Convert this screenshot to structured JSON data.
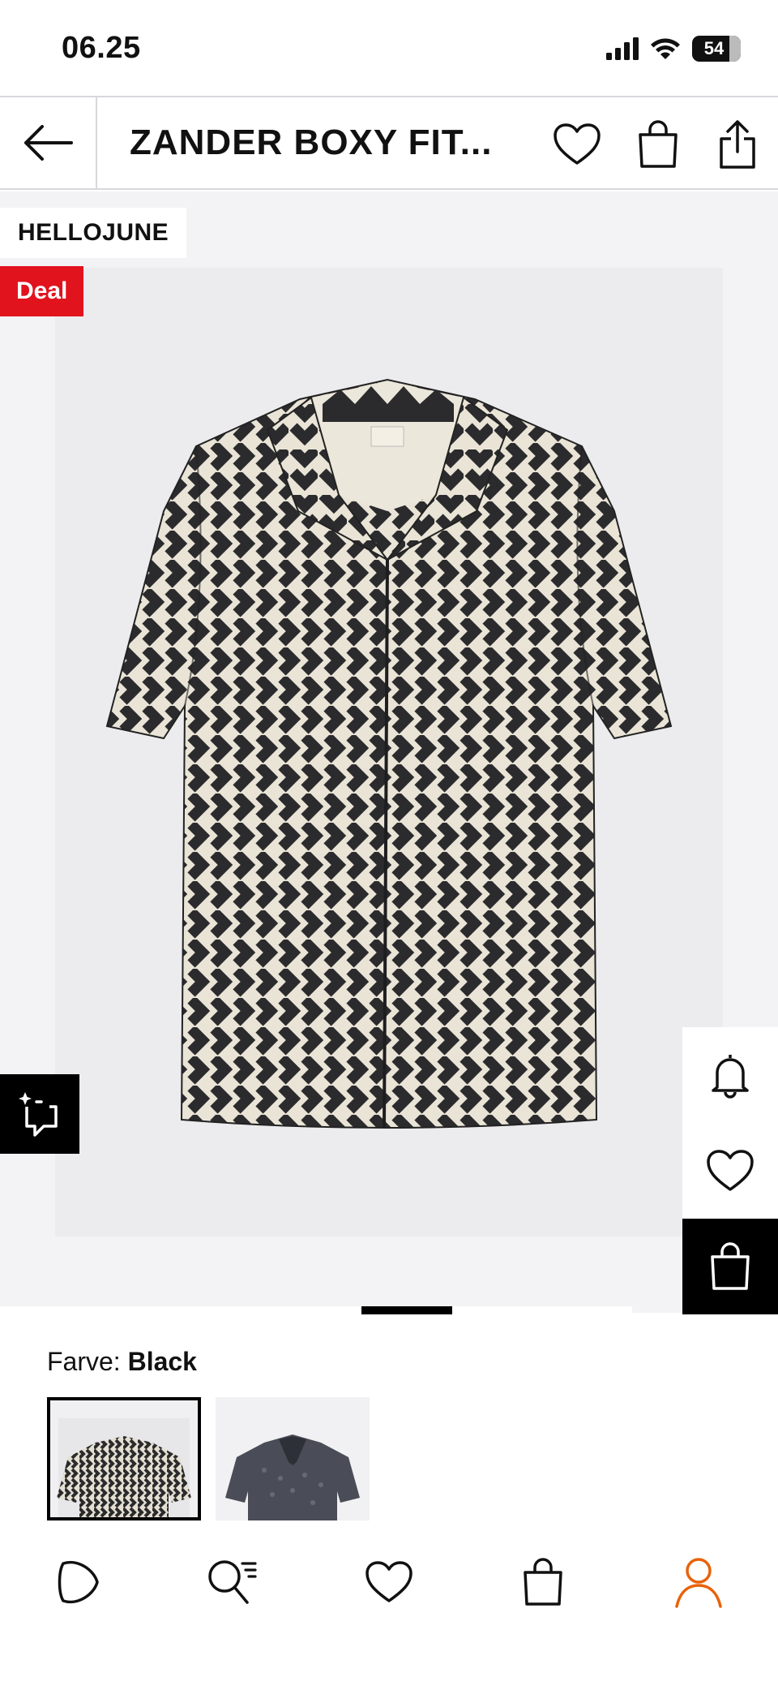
{
  "status_bar": {
    "time": "06.25",
    "battery": "54",
    "icons": [
      "signal-icon",
      "wifi-icon",
      "battery-icon"
    ]
  },
  "header": {
    "title": "ZANDER BOXY FIT...",
    "icons": [
      "back-arrow-icon",
      "heart-icon",
      "shopping-bag-icon",
      "share-icon"
    ]
  },
  "product": {
    "brand": "HELLOJUNE",
    "deal_badge": "Deal",
    "image_index": 2
  },
  "side_actions": [
    "bell-icon",
    "heart-icon",
    "shopping-bag-icon"
  ],
  "color": {
    "label": "Farve:",
    "value": "Black",
    "swatches": [
      "Black",
      "Navy"
    ]
  },
  "bottom_nav": {
    "items": [
      "home-icon",
      "search-icon",
      "wishlist-icon",
      "bag-icon",
      "profile-icon"
    ],
    "active": "profile-icon",
    "accent": "#e8630a"
  },
  "colors": {
    "deal_red": "#e1141e",
    "pattern_dark": "#2b2b2e",
    "pattern_light": "#e9e4d6"
  }
}
